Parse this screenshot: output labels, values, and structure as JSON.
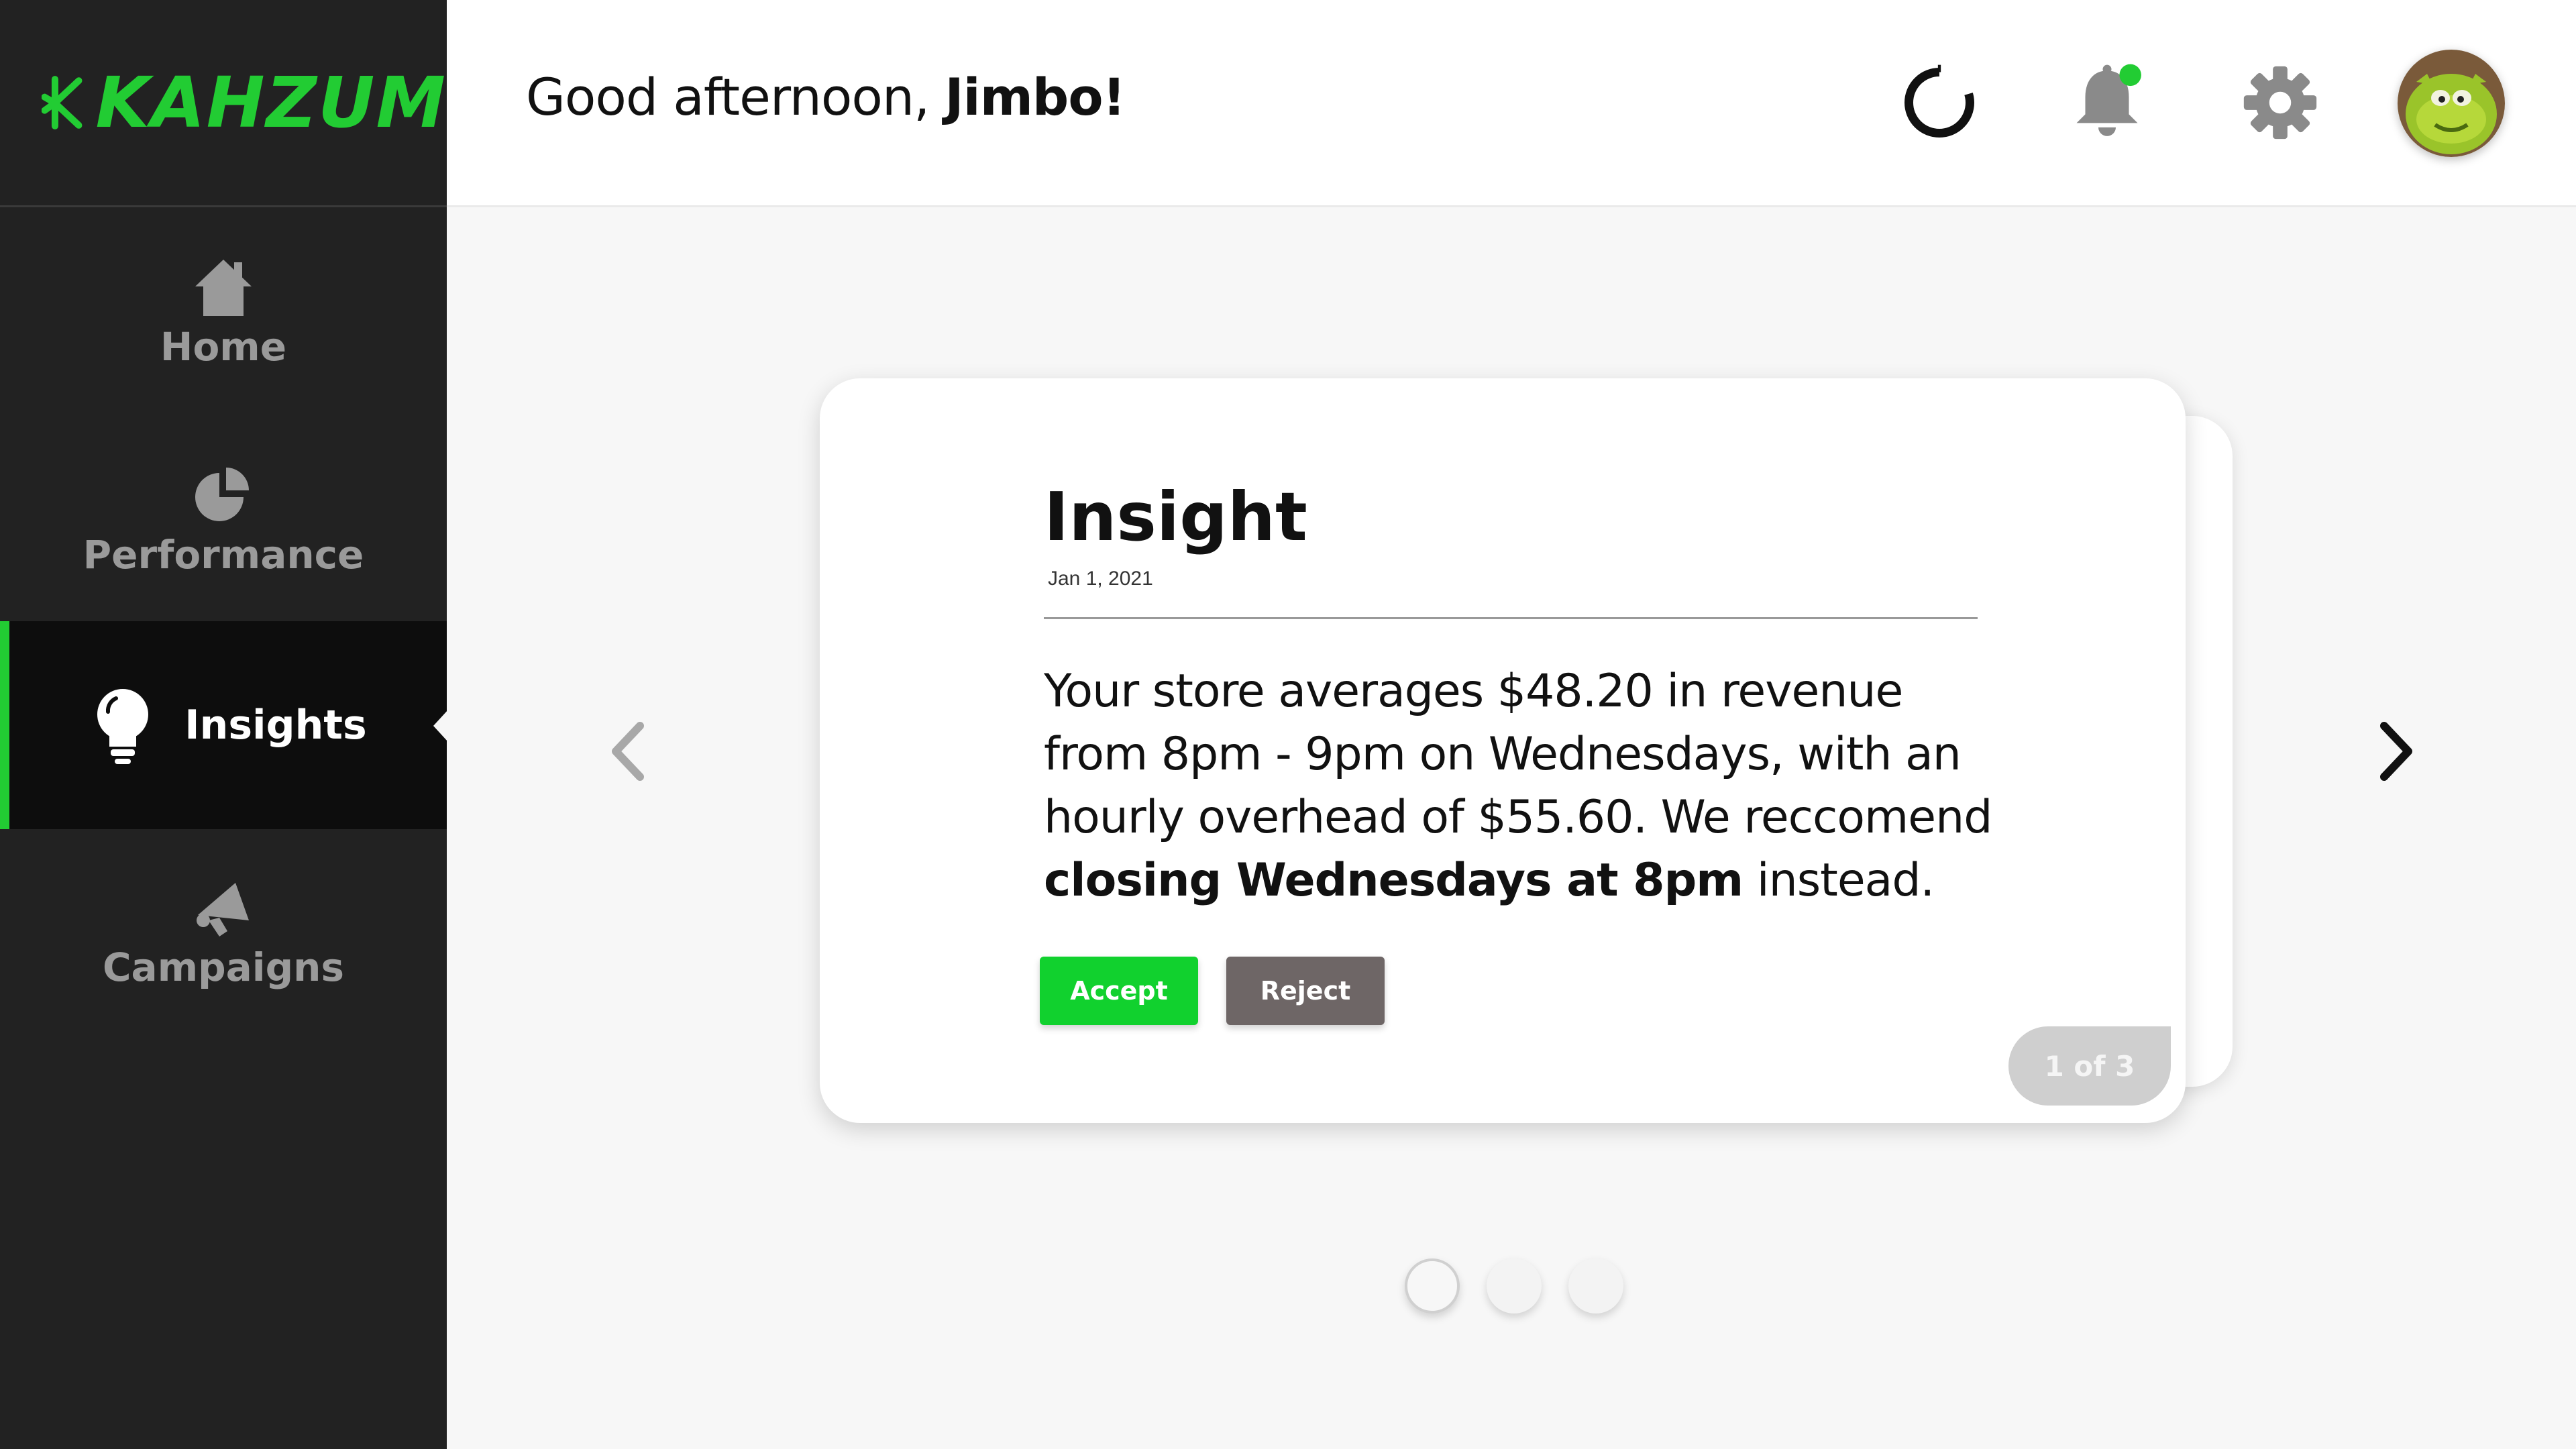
{
  "brand": {
    "name": "KAHZUM",
    "color": "#22cc33"
  },
  "sidebar": {
    "items": [
      {
        "label": "Home",
        "icon": "home-icon",
        "active": false
      },
      {
        "label": "Performance",
        "icon": "pie-chart-icon",
        "active": false
      },
      {
        "label": "Insights",
        "icon": "lightbulb-icon",
        "active": true
      },
      {
        "label": "Campaigns",
        "icon": "megaphone-icon",
        "active": false
      }
    ]
  },
  "header": {
    "greeting_prefix": "Good afternoon, ",
    "greeting_name": "Jimbo!",
    "icons": [
      "progress-ring-icon",
      "bell-icon",
      "gear-icon",
      "avatar"
    ],
    "notification_dot_color": "#22cc33"
  },
  "insight": {
    "title": "Insight",
    "date": "Jan 1, 2021",
    "body_part1": "Your store averages $48.20 in revenue from 8pm - 9pm on Wednesdays, with an hourly overhead of $55.60. We reccomend ",
    "body_bold": "closing Wednesdays at 8pm",
    "body_part2": " instead.",
    "accept_label": "Accept",
    "reject_label": "Reject",
    "pager": "1 of 3"
  },
  "carousel": {
    "total": 3,
    "current": 1
  },
  "colors": {
    "accent": "#22cc33",
    "sidebar": "#222222",
    "reject": "#6e6666"
  }
}
